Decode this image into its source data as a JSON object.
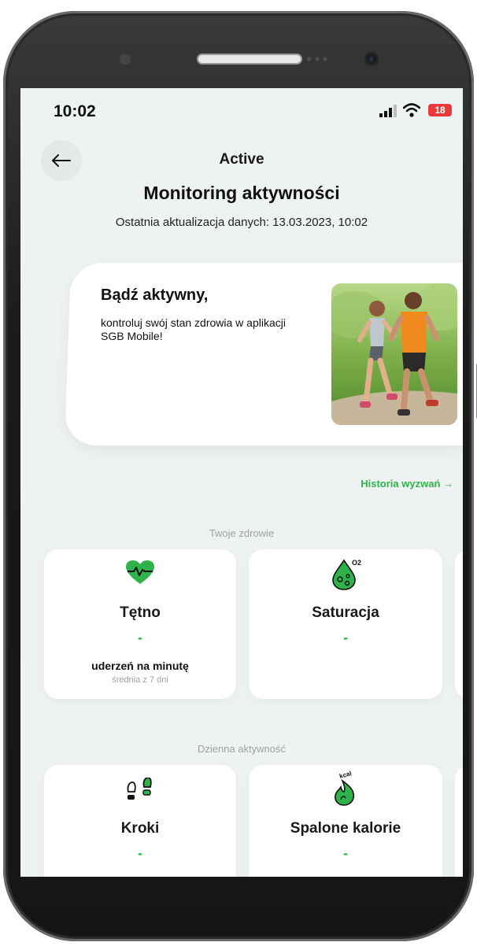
{
  "status_bar": {
    "time": "10:02",
    "battery": "18"
  },
  "header": {
    "nav_title": "Active",
    "title": "Monitoring aktywności",
    "last_update": "Ostatnia aktualizacja danych: 13.03.2023, 10:02"
  },
  "promo": {
    "title": "Bądź aktywny,",
    "text": "kontroluj swój stan zdrowia w aplikacji SGB Mobile!"
  },
  "history_link": "Historia wyzwań →",
  "health": {
    "section_label": "Twoje zdrowie",
    "cards": [
      {
        "title": "Tętno",
        "value": "-",
        "unit": "uderzeń na minutę",
        "sub": "średnia z 7 dni"
      },
      {
        "title": "Saturacja",
        "value": "-"
      }
    ]
  },
  "activity": {
    "section_label": "Dzienna aktywność",
    "cards": [
      {
        "title": "Kroki",
        "value": "-"
      },
      {
        "title": "Spalone kalorie",
        "value": "-"
      }
    ]
  },
  "colors": {
    "accent": "#2fb24a",
    "battery": "#e83a3a",
    "background": "#eef2f2"
  }
}
